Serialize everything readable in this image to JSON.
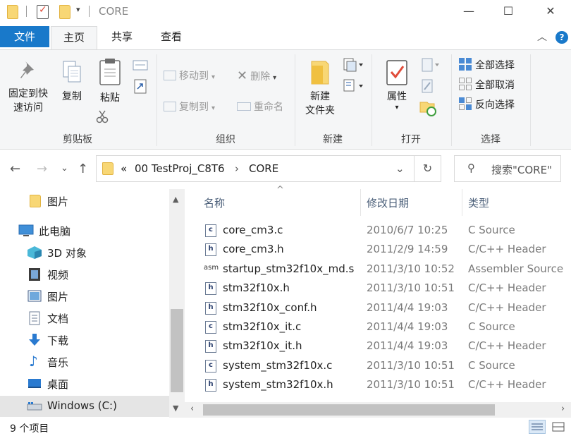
{
  "window": {
    "title": "CORE",
    "minimize_icon": "—",
    "maximize_icon": "☐",
    "close_icon": "✕"
  },
  "ribbon_tabs": {
    "file": "文件",
    "home": "主页",
    "share": "共享",
    "view": "查看",
    "collapse_icon": "︿",
    "help_icon": "?"
  },
  "ribbon": {
    "clipboard": {
      "pin_line1": "固定到快",
      "pin_line2": "速访问",
      "copy": "复制",
      "paste": "粘贴",
      "group": "剪贴板"
    },
    "organize": {
      "move_to": "移动到",
      "copy_to": "复制到",
      "delete": "删除",
      "rename": "重命名",
      "group": "组织"
    },
    "new": {
      "new_folder_line1": "新建",
      "new_folder_line2": "文件夹",
      "group": "新建"
    },
    "open": {
      "properties": "属性",
      "group": "打开"
    },
    "select": {
      "select_all": "全部选择",
      "select_none": "全部取消",
      "invert": "反向选择",
      "group": "选择"
    }
  },
  "address": {
    "back_icon": "←",
    "forward_icon": "→",
    "recent_icon": "⌄",
    "up_icon": "↑",
    "overflow": "«",
    "crumb1": "00 TestProj_C8T6",
    "crumb_sep": "›",
    "crumb2": "CORE",
    "dropdown_icon": "⌄",
    "refresh_icon": "↻",
    "search_icon": "⚲",
    "search_placeholder": "搜索\"CORE\""
  },
  "nav": {
    "items": [
      {
        "label": "图片",
        "icon": "pictures-folder-icon"
      },
      {
        "label": "此电脑",
        "icon": "computer-icon"
      },
      {
        "label": "3D 对象",
        "icon": "3d-objects-icon"
      },
      {
        "label": "视频",
        "icon": "videos-icon"
      },
      {
        "label": "图片",
        "icon": "pictures-icon"
      },
      {
        "label": "文档",
        "icon": "documents-icon"
      },
      {
        "label": "下载",
        "icon": "downloads-icon"
      },
      {
        "label": "音乐",
        "icon": "music-icon"
      },
      {
        "label": "桌面",
        "icon": "desktop-icon"
      },
      {
        "label": "Windows (C:)",
        "icon": "drive-icon"
      }
    ]
  },
  "columns": {
    "name": "名称",
    "date": "修改日期",
    "type": "类型",
    "sort_icon": "^"
  },
  "files": [
    {
      "name": "core_cm3.c",
      "date": "2010/6/7 10:25",
      "type": "C Source",
      "icon": "c"
    },
    {
      "name": "core_cm3.h",
      "date": "2011/2/9 14:59",
      "type": "C/C++ Header",
      "icon": "h"
    },
    {
      "name": "startup_stm32f10x_md.s",
      "date": "2011/3/10 10:52",
      "type": "Assembler Source",
      "icon": "asm"
    },
    {
      "name": "stm32f10x.h",
      "date": "2011/3/10 10:51",
      "type": "C/C++ Header",
      "icon": "h"
    },
    {
      "name": "stm32f10x_conf.h",
      "date": "2011/4/4 19:03",
      "type": "C/C++ Header",
      "icon": "h"
    },
    {
      "name": "stm32f10x_it.c",
      "date": "2011/4/4 19:03",
      "type": "C Source",
      "icon": "c"
    },
    {
      "name": "stm32f10x_it.h",
      "date": "2011/4/4 19:03",
      "type": "C/C++ Header",
      "icon": "h"
    },
    {
      "name": "system_stm32f10x.c",
      "date": "2011/3/10 10:51",
      "type": "C Source",
      "icon": "c"
    },
    {
      "name": "system_stm32f10x.h",
      "date": "2011/3/10 10:51",
      "type": "C/C++ Header",
      "icon": "h"
    }
  ],
  "status": {
    "item_count": "9 个项目"
  },
  "colors": {
    "file_tab": "#1979ca",
    "folder": "#f8d775",
    "ribbon_bg": "#f5f6f7"
  }
}
